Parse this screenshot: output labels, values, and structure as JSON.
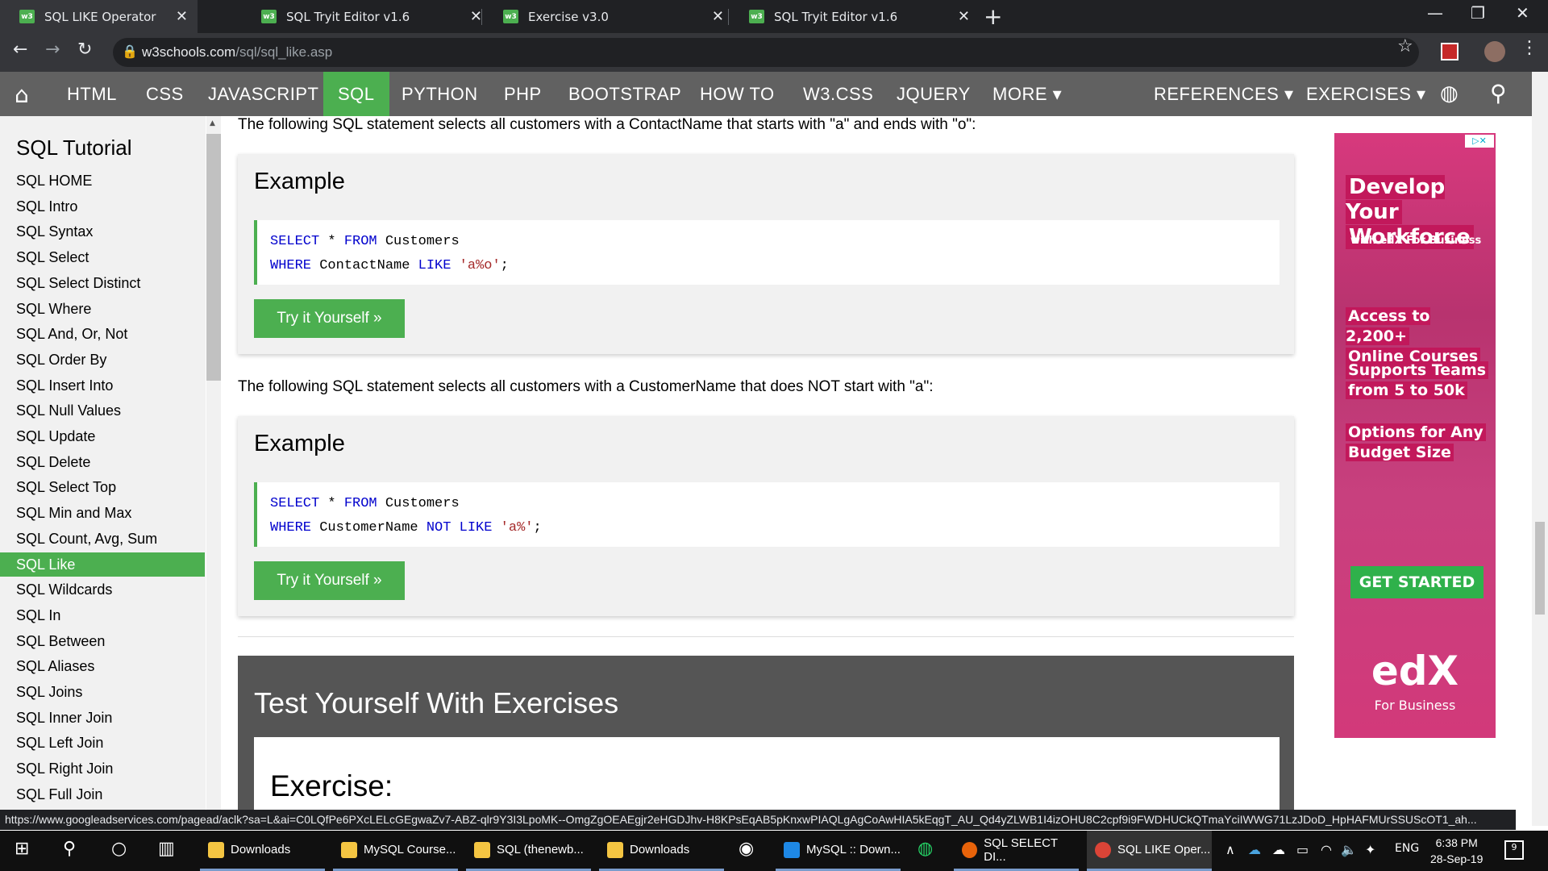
{
  "browser": {
    "tabs": [
      {
        "title": "SQL LIKE Operator",
        "favicon": "w3"
      },
      {
        "title": "SQL Tryit Editor v1.6",
        "favicon": "w3"
      },
      {
        "title": "Exercise v3.0",
        "favicon": "w3"
      },
      {
        "title": "SQL Tryit Editor v1.6",
        "favicon": "w3"
      }
    ],
    "url_host": "w3schools.com",
    "url_path": "/sql/sql_like.asp"
  },
  "topnav": {
    "items": [
      "HTML",
      "CSS",
      "JAVASCRIPT",
      "SQL",
      "PYTHON",
      "PHP",
      "BOOTSTRAP",
      "HOW TO",
      "W3.CSS",
      "JQUERY",
      "MORE ▾",
      "REFERENCES ▾",
      "EXERCISES ▾"
    ],
    "active": "SQL"
  },
  "sidebar": {
    "title": "SQL Tutorial",
    "items": [
      "SQL HOME",
      "SQL Intro",
      "SQL Syntax",
      "SQL Select",
      "SQL Select Distinct",
      "SQL Where",
      "SQL And, Or, Not",
      "SQL Order By",
      "SQL Insert Into",
      "SQL Null Values",
      "SQL Update",
      "SQL Delete",
      "SQL Select Top",
      "SQL Min and Max",
      "SQL Count, Avg, Sum",
      "SQL Like",
      "SQL Wildcards",
      "SQL In",
      "SQL Between",
      "SQL Aliases",
      "SQL Joins",
      "SQL Inner Join",
      "SQL Left Join",
      "SQL Right Join",
      "SQL Full Join"
    ],
    "active": "SQL Like"
  },
  "content": {
    "para1": "The following SQL statement selects all customers with a ContactName that starts with \"a\" and ends with \"o\":",
    "example1": {
      "heading": "Example",
      "line1": [
        "SELECT",
        " * ",
        "FROM",
        " Customers"
      ],
      "line2": [
        "WHERE",
        " ContactName ",
        "LIKE",
        " ",
        "'a%o'",
        ";"
      ],
      "button": "Try it Yourself »"
    },
    "para2": "The following SQL statement selects all customers with a CustomerName that does NOT start with \"a\":",
    "example2": {
      "heading": "Example",
      "line1": [
        "SELECT",
        " * ",
        "FROM",
        " Customers"
      ],
      "line2": [
        "WHERE",
        " CustomerName ",
        "NOT LIKE",
        " ",
        "'a%'",
        ";"
      ],
      "button": "Try it Yourself »"
    },
    "exercises_heading": "Test Yourself With Exercises",
    "exercise_label": "Exercise:"
  },
  "ad": {
    "badge": "▷✕",
    "headline1": "Develop Your",
    "headline2": "Workforce",
    "sub": "with edX For Business",
    "line1a": "Access to 2,200+",
    "line1b": "Online Courses",
    "line2a": "Supports Teams",
    "line2b": "from 5 to 50k",
    "line3a": "Options for Any",
    "line3b": "Budget Size",
    "cta": "GET STARTED",
    "logo": "edX",
    "logo_sub": "For Business"
  },
  "status_url": "https://www.googleadservices.com/pagead/aclk?sa=L&ai=C0LQfPe6PXcLELcGEgwaZv7-ABZ-qlr9Y3I3LpoMK--OmgZgOEAEgjr2eHGDJhv-H8KPsEqAB5pKnxwPIAQLgAgCoAwHIA5kEqgT_AU_Qd4yZLWB1I4izOHU8C2cpf9i9FWDHUCkQTmaYciIWWG71LzJDoD_HpHAFMUrSSUScOT1_ah...",
  "taskbar": {
    "apps": [
      "Downloads",
      "MySQL Course...",
      "SQL (thenewb...",
      "Downloads",
      "MySQL :: Down...",
      "SQL SELECT DI...",
      "SQL LIKE Oper..."
    ],
    "lang": "ENG",
    "time": "6:38 PM",
    "date": "28-Sep-19",
    "notif": "9"
  }
}
